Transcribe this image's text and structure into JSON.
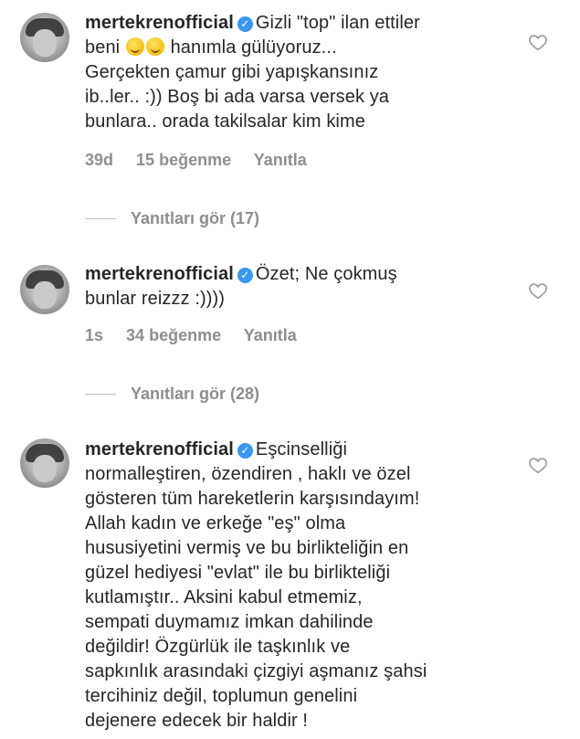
{
  "comments": [
    {
      "username": "mertekrenofficial",
      "text_line1": "Gizli \"top\" ilan ettiler",
      "text_line2_before": "beni",
      "text_line2_after": "hanımla gülüyoruz...",
      "text_line3": "Gerçekten çamur gibi yapışkansınız",
      "text_line4": "ib..ler.. :)) Boş bi ada varsa versek ya",
      "text_line5": "bunlara.. orada takilsalar kim kime",
      "time": "39d",
      "likes": "15 beğenme",
      "reply_label": "Yanıtla",
      "view_replies": "Yanıtları gör (17)",
      "emoji": "laughing-rolling-emoji"
    },
    {
      "username": "mertekrenofficial",
      "text_line1": "Özet; Ne çokmuş",
      "text_line2": "bunlar reizzz :))))",
      "time": "1s",
      "likes": "34 beğenme",
      "reply_label": "Yanıtla",
      "view_replies": "Yanıtları gör (28)"
    },
    {
      "username": "mertekrenofficial",
      "text_line1": "Eşcinselliği",
      "lines": [
        "normalleştiren, özendiren , haklı ve özel",
        "gösteren tüm hareketlerin karşısındayım!",
        "Allah kadın ve erkeğe \"eş\" olma",
        "hususiyetini vermiş ve bu birlikteliğin en",
        "güzel hediyesi \"evlat\" ile bu birlikteliği",
        "kutlamıştır.. Aksini kabul etmemiz,",
        "sempati duymamız imkan dahilinde",
        "değildir! Özgürlük ile taşkınlık ve",
        "sapkınlık arasındaki çizgiyi aşmanız şahsi",
        "tercihiniz değil, toplumun genelini",
        "dejenere edecek bir haldir !"
      ]
    }
  ],
  "colors": {
    "text": "#262626",
    "meta": "#8e8e8e",
    "verified": "#3897f0"
  }
}
